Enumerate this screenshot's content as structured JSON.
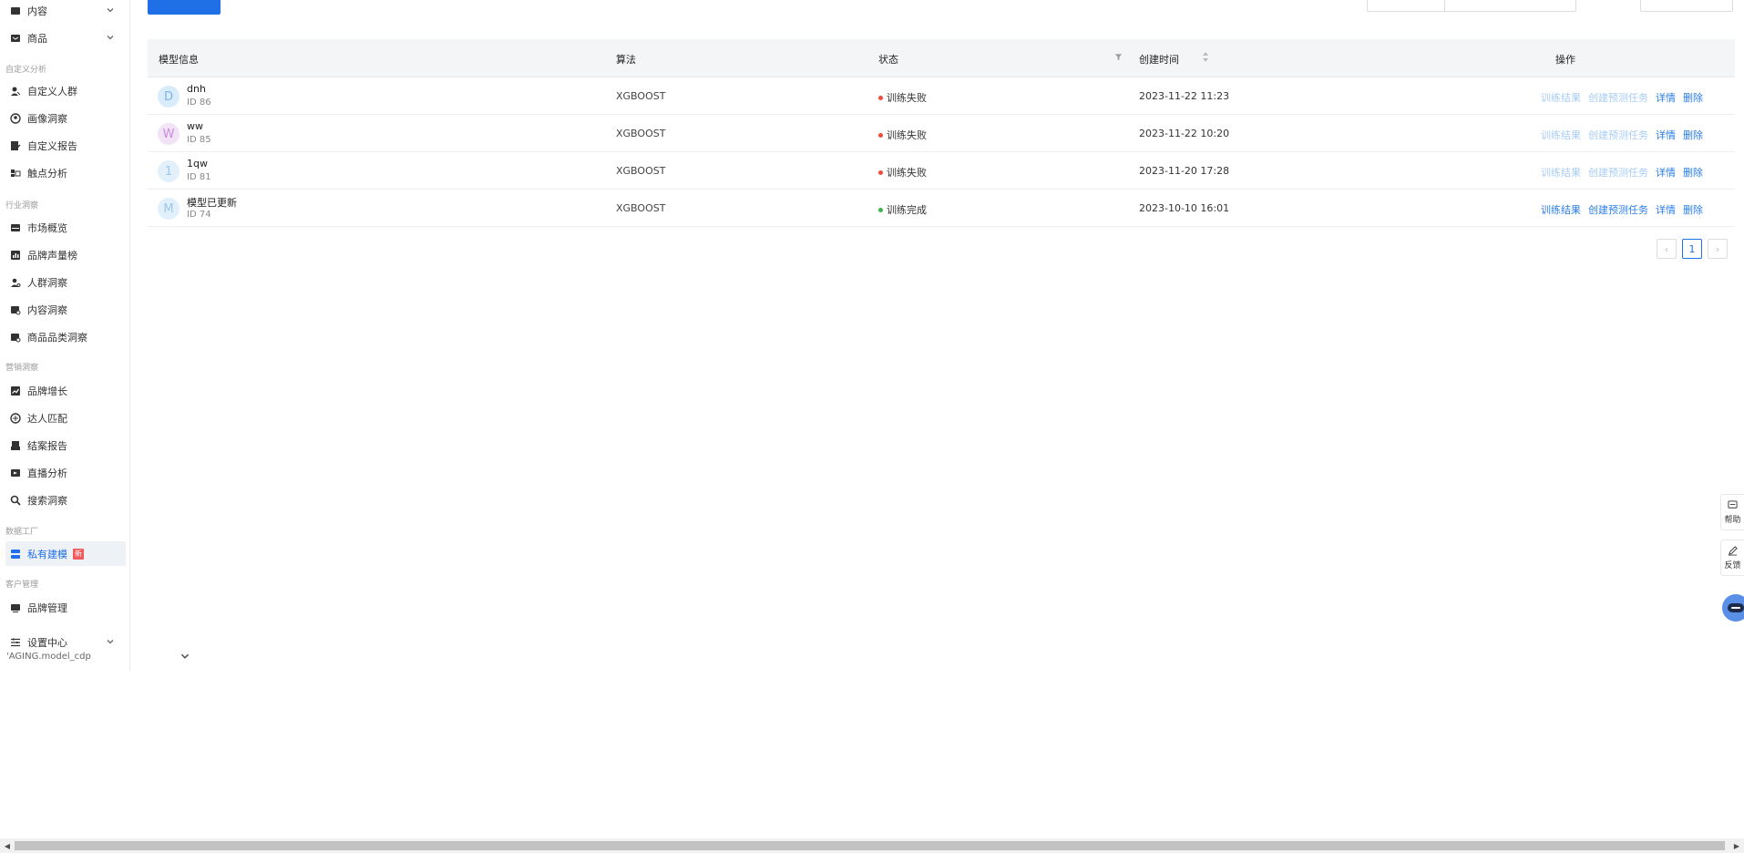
{
  "sidebar": {
    "items": [
      {
        "label": "内容",
        "icon": "content-icon",
        "has_chevron": true
      },
      {
        "label": "商品",
        "icon": "goods-icon",
        "has_chevron": true
      },
      {
        "label": "自定义人群",
        "icon": "custom-crowd-icon"
      },
      {
        "label": "画像洞察",
        "icon": "portrait-icon"
      },
      {
        "label": "自定义报告",
        "icon": "custom-report-icon"
      },
      {
        "label": "触点分析",
        "icon": "touchpoint-icon"
      },
      {
        "label": "市场概览",
        "icon": "market-icon"
      },
      {
        "label": "品牌声量榜",
        "icon": "brand-volume-icon"
      },
      {
        "label": "人群洞察",
        "icon": "crowd-insight-icon"
      },
      {
        "label": "内容洞察",
        "icon": "content-insight-icon"
      },
      {
        "label": "商品品类洞察",
        "icon": "category-insight-icon"
      },
      {
        "label": "品牌增长",
        "icon": "brand-growth-icon"
      },
      {
        "label": "达人匹配",
        "icon": "influencer-icon"
      },
      {
        "label": "结案报告",
        "icon": "closing-report-icon"
      },
      {
        "label": "直播分析",
        "icon": "live-icon"
      },
      {
        "label": "搜索洞察",
        "icon": "search-icon"
      },
      {
        "label": "私有建模",
        "icon": "modeling-icon",
        "active": true,
        "badge": "新"
      },
      {
        "label": "品牌管理",
        "icon": "brand-manage-icon"
      },
      {
        "label": "设置中心",
        "icon": "settings-icon",
        "has_chevron": true
      }
    ],
    "sections": {
      "custom_analysis": "自定义分析",
      "industry_insight": "行业洞察",
      "marketing_insight": "营销洞察",
      "data_factory": "数据工厂",
      "customer_manage": "客户管理"
    },
    "env_label": "'AGING.model_cdp"
  },
  "table": {
    "headers": {
      "model_info": "模型信息",
      "algorithm": "算法",
      "status": "状态",
      "created_time": "创建时间",
      "actions": "操作"
    },
    "rows": [
      {
        "avatar": "D",
        "avatar_color": "#d8ecfb",
        "avatar_text_color": "#7fb5e6",
        "name": "dnh",
        "id": "ID 86",
        "algorithm": "XGBOOST",
        "status": "训练失败",
        "status_color": "#f04a3f",
        "time": "2023-11-22 11:23",
        "actions_enabled": false
      },
      {
        "avatar": "W",
        "avatar_color": "#f3e3f7",
        "avatar_text_color": "#c88bdc",
        "name": "ww",
        "id": "ID 85",
        "algorithm": "XGBOOST",
        "status": "训练失败",
        "status_color": "#f04a3f",
        "time": "2023-11-22 10:20",
        "actions_enabled": false
      },
      {
        "avatar": "1",
        "avatar_color": "#e1f0fb",
        "avatar_text_color": "#9ac6ea",
        "name": "1qw",
        "id": "ID 81",
        "algorithm": "XGBOOST",
        "status": "训练失败",
        "status_color": "#f04a3f",
        "time": "2023-11-20 17:28",
        "actions_enabled": false
      },
      {
        "avatar": "M",
        "avatar_color": "#e1f0fb",
        "avatar_text_color": "#9ac6ea",
        "name": "模型已更新",
        "id": "ID 74",
        "algorithm": "XGBOOST",
        "status": "训练完成",
        "status_color": "#3bb54a",
        "time": "2023-10-10 16:01",
        "actions_enabled": true
      }
    ],
    "action_labels": {
      "result": "训练结果",
      "create_task": "创建预测任务",
      "detail": "详情",
      "delete": "删除"
    }
  },
  "pagination": {
    "current_page": "1",
    "prev": "‹",
    "next": "›"
  },
  "float_tools": {
    "help": "帮助",
    "feedback": "反馈"
  }
}
